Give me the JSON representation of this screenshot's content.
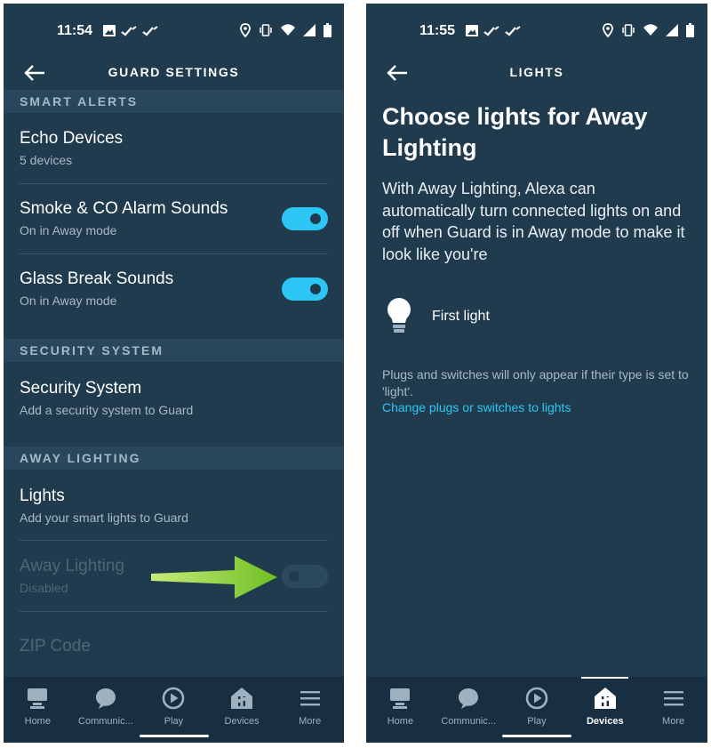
{
  "left": {
    "status": {
      "time": "11:54"
    },
    "appbar": {
      "title": "GUARD SETTINGS"
    },
    "sections": {
      "smart_alerts": "SMART ALERTS",
      "security_system": "SECURITY SYSTEM",
      "away_lighting": "AWAY LIGHTING"
    },
    "rows": {
      "echo": {
        "title": "Echo Devices",
        "sub": "5 devices"
      },
      "smoke": {
        "title": "Smoke & CO Alarm Sounds",
        "sub": "On in Away mode",
        "toggle_on": true
      },
      "glass": {
        "title": "Glass Break Sounds",
        "sub": "On in Away mode",
        "toggle_on": true
      },
      "security": {
        "title": "Security System",
        "sub": "Add a security system to Guard"
      },
      "lights": {
        "title": "Lights",
        "sub": "Add your smart lights to Guard"
      },
      "away": {
        "title": "Away Lighting",
        "sub": "Disabled",
        "toggle_on": false
      },
      "zip": {
        "title": "ZIP Code"
      }
    },
    "nav": [
      "Home",
      "Communic...",
      "Play",
      "Devices",
      "More"
    ]
  },
  "right": {
    "status": {
      "time": "11:55"
    },
    "appbar": {
      "title": "LIGHTS"
    },
    "heading": "Choose lights for Away Lighting",
    "body": "With Away Lighting, Alexa can automatically turn connected lights on and off when Guard is in Away mode to make it look like you're",
    "light": {
      "label": "First light",
      "icon": "bulb-icon"
    },
    "note": "Plugs and switches will only appear if their type is set to 'light'.",
    "link": "Change plugs or switches to lights",
    "nav": [
      "Home",
      "Communic...",
      "Play",
      "Devices",
      "More"
    ],
    "active_nav": "Devices"
  },
  "colors": {
    "background": "#203b4e",
    "section": "#28475c",
    "accent": "#2bc6f4",
    "arrow": "#8ed43a"
  }
}
